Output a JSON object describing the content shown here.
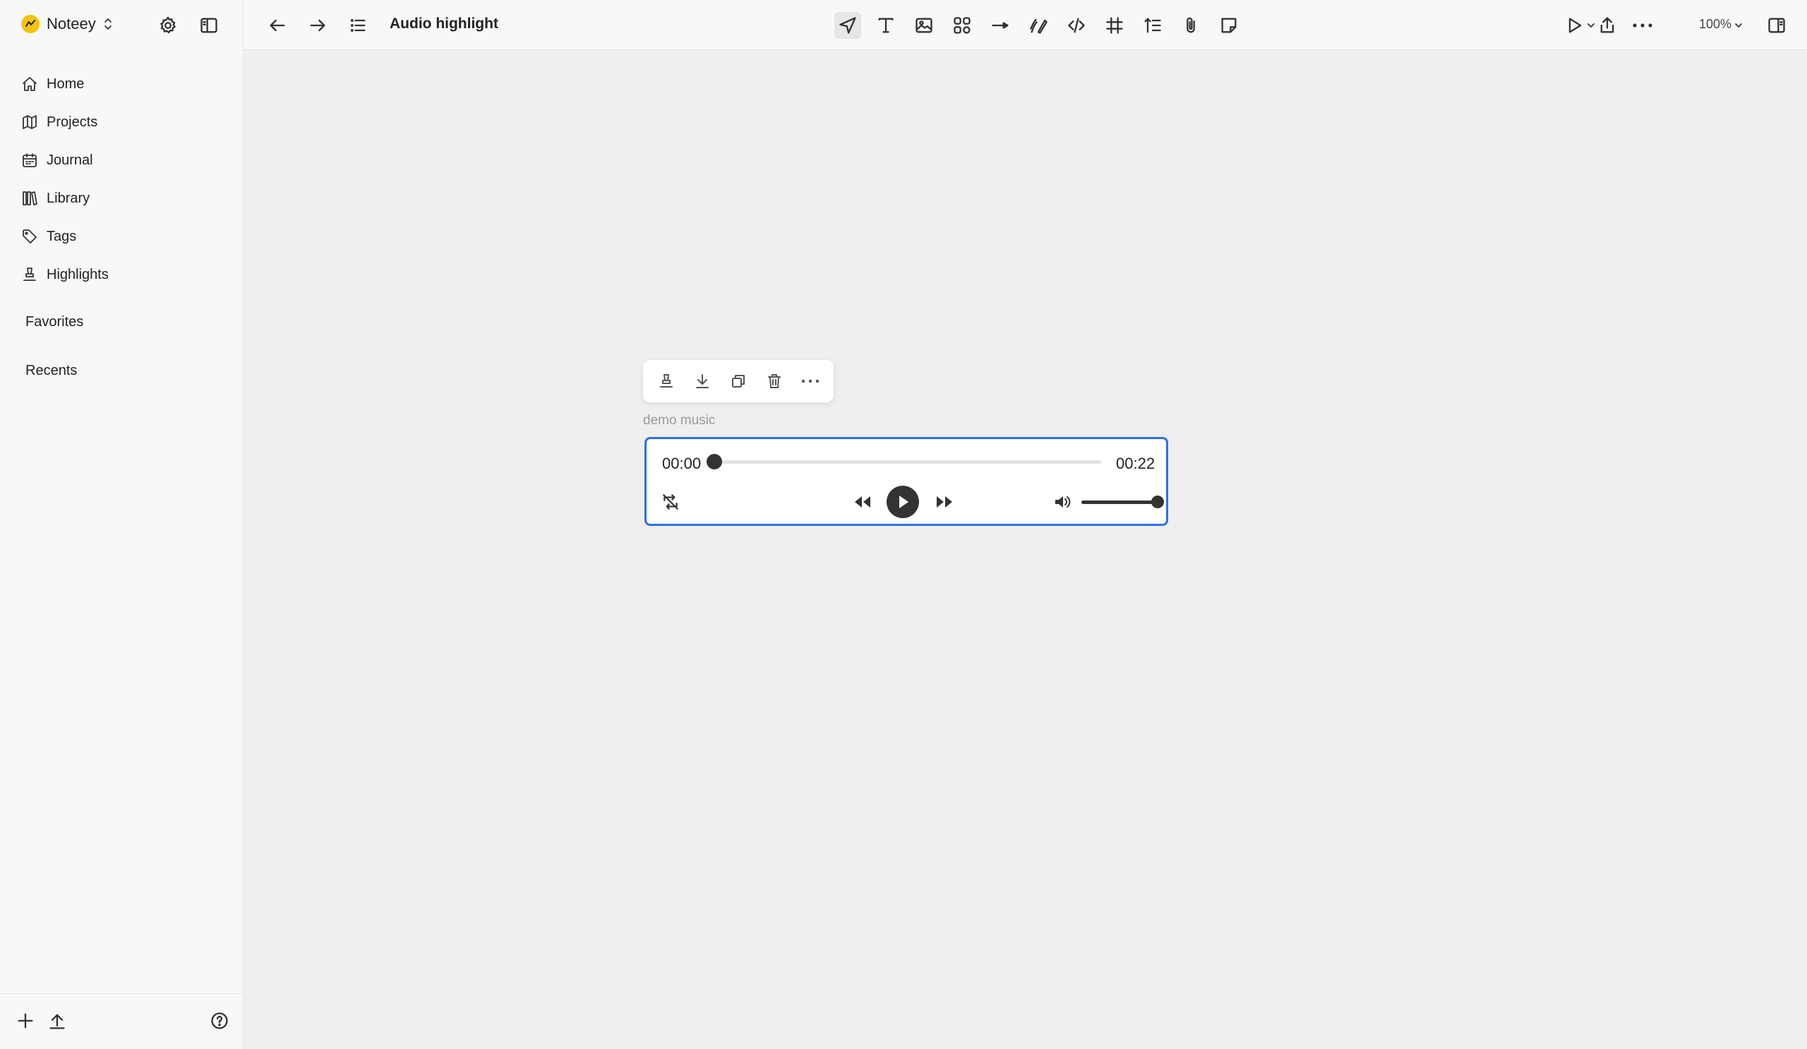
{
  "app": {
    "name": "Noteey"
  },
  "sidebar": {
    "nav": [
      {
        "label": "Home",
        "icon": "home-icon"
      },
      {
        "label": "Projects",
        "icon": "map-icon"
      },
      {
        "label": "Journal",
        "icon": "calendar-icon"
      },
      {
        "label": "Library",
        "icon": "library-icon"
      },
      {
        "label": "Tags",
        "icon": "tag-icon"
      },
      {
        "label": "Highlights",
        "icon": "highlighter-icon"
      }
    ],
    "favorites_label": "Favorites",
    "recents_label": "Recents"
  },
  "topbar": {
    "title": "Audio highlight",
    "zoom": "100%",
    "tools": [
      "select-icon",
      "text-icon",
      "image-icon",
      "widgets-icon",
      "arrow-icon",
      "pen-icon",
      "code-icon",
      "frame-icon",
      "list-icon",
      "attachment-icon",
      "sticky-note-icon"
    ]
  },
  "audio_block": {
    "caption": "demo music",
    "current_time": "00:00",
    "duration": "00:22",
    "progress": 0,
    "volume": 1.0,
    "toolbar": [
      "highlight-icon",
      "download-icon",
      "duplicate-icon",
      "delete-icon",
      "more-icon"
    ]
  },
  "colors": {
    "accent": "#2f6fe4",
    "brand": "#f4c20d",
    "canvas": "#efefef",
    "sidebar": "#f8f8f8"
  }
}
